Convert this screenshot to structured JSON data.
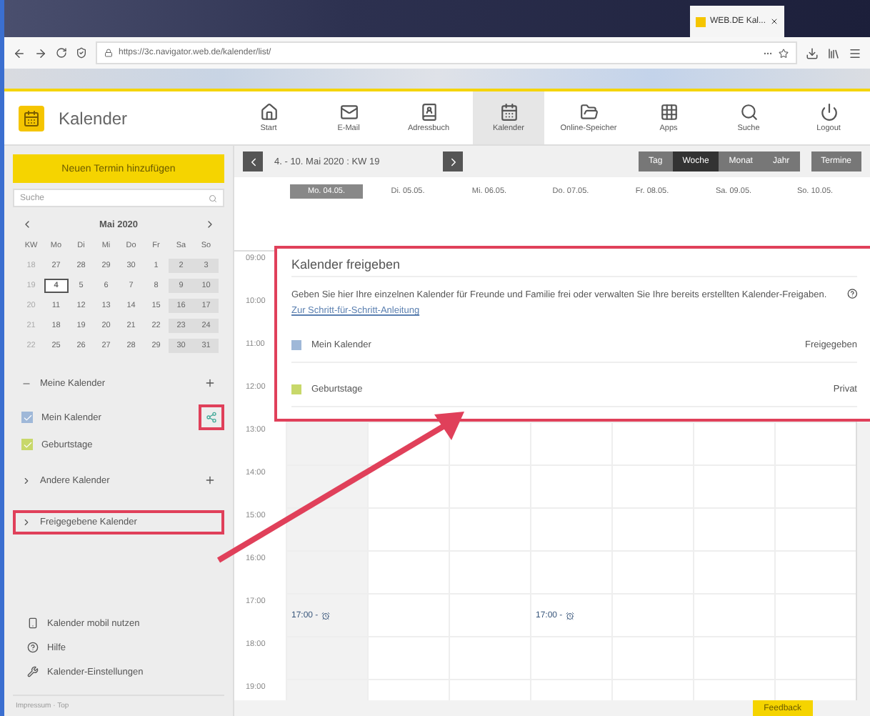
{
  "browser": {
    "tab_title": "WEB.DE Kal...",
    "url": "https://3c.navigator.web.de/kalender/list/"
  },
  "app": {
    "title": "Kalender",
    "nav": [
      {
        "label": "Start",
        "selected": false
      },
      {
        "label": "E-Mail",
        "selected": false
      },
      {
        "label": "Adressbuch",
        "selected": false
      },
      {
        "label": "Kalender",
        "selected": true
      },
      {
        "label": "Online-Speicher",
        "selected": false
      },
      {
        "label": "Apps",
        "selected": false
      },
      {
        "label": "Suche",
        "selected": false
      },
      {
        "label": "Logout",
        "selected": false
      }
    ]
  },
  "sidebar": {
    "new_button": "Neuen Termin hinzufügen",
    "search": {
      "placeholder": "Suche"
    },
    "mini_calendar": {
      "title": "Mai 2020",
      "weekdays": [
        "KW",
        "Mo",
        "Di",
        "Mi",
        "Do",
        "Fr",
        "Sa",
        "So"
      ],
      "weeks": [
        {
          "week": "18",
          "days": [
            {
              "label": "27",
              "today": false
            },
            {
              "label": "28",
              "today": false
            },
            {
              "label": "29",
              "today": false
            },
            {
              "label": "30",
              "today": false
            },
            {
              "label": "1",
              "today": false
            },
            {
              "label": "2",
              "today": false
            },
            {
              "label": "3",
              "today": false
            }
          ]
        },
        {
          "week": "19",
          "days": [
            {
              "label": "4",
              "today": true
            },
            {
              "label": "5",
              "today": false
            },
            {
              "label": "6",
              "today": false
            },
            {
              "label": "7",
              "today": false
            },
            {
              "label": "8",
              "today": false
            },
            {
              "label": "9",
              "today": false
            },
            {
              "label": "10",
              "today": false
            }
          ]
        },
        {
          "week": "20",
          "days": [
            {
              "label": "11",
              "today": false
            },
            {
              "label": "12",
              "today": false
            },
            {
              "label": "13",
              "today": false
            },
            {
              "label": "14",
              "today": false
            },
            {
              "label": "15",
              "today": false
            },
            {
              "label": "16",
              "today": false
            },
            {
              "label": "17",
              "today": false
            }
          ]
        },
        {
          "week": "21",
          "days": [
            {
              "label": "18",
              "today": false
            },
            {
              "label": "19",
              "today": false
            },
            {
              "label": "20",
              "today": false
            },
            {
              "label": "21",
              "today": false
            },
            {
              "label": "22",
              "today": false
            },
            {
              "label": "23",
              "today": false
            },
            {
              "label": "24",
              "today": false
            }
          ]
        },
        {
          "week": "22",
          "days": [
            {
              "label": "25",
              "today": false
            },
            {
              "label": "26",
              "today": false
            },
            {
              "label": "27",
              "today": false
            },
            {
              "label": "28",
              "today": false
            },
            {
              "label": "29",
              "today": false
            },
            {
              "label": "30",
              "today": false
            },
            {
              "label": "31",
              "today": false
            }
          ]
        }
      ]
    },
    "groups": [
      {
        "title": "Meine Kalender",
        "expanded": true,
        "highlighted": false,
        "items": [
          {
            "label": "Mein Kalender",
            "checked": true,
            "color": "#9fb8d8",
            "shared": true,
            "highlighted": true
          },
          {
            "label": "Geburtstage",
            "checked": true,
            "color": "#c8d86a",
            "shared": false
          }
        ]
      },
      {
        "title": "Andere Kalender",
        "expanded": false,
        "highlighted": false
      },
      {
        "title": "Freigegebene Kalender",
        "expanded": false,
        "highlighted": true
      }
    ],
    "links": [
      "Kalender mobil nutzen",
      "Hilfe",
      "Kalender-Einstellungen"
    ],
    "footer": "Impressum · Top"
  },
  "calendar": {
    "range": "4. - 10. Mai 2020 : KW 19",
    "views": [
      {
        "label": "Tag",
        "selected": false
      },
      {
        "label": "Woche",
        "selected": true
      },
      {
        "label": "Monat",
        "selected": false
      },
      {
        "label": "Jahr",
        "selected": false
      }
    ],
    "list_button": "Termine",
    "days": [
      {
        "label": "Mo. 04.05.",
        "today": true,
        "event": "17:00 -"
      },
      {
        "label": "Di. 05.05.",
        "today": false
      },
      {
        "label": "Mi. 06.05.",
        "today": false
      },
      {
        "label": "Do. 07.05.",
        "today": false,
        "event": "17:00 -"
      },
      {
        "label": "Fr. 08.05.",
        "today": false
      },
      {
        "label": "Sa. 09.05.",
        "today": false
      },
      {
        "label": "So. 10.05.",
        "today": false
      }
    ],
    "hours": [
      "09:00",
      "10:00",
      "11:00",
      "12:00",
      "13:00",
      "14:00",
      "15:00",
      "16:00",
      "17:00",
      "18:00",
      "19:00"
    ],
    "feedback": "Feedback"
  },
  "share_dialog": {
    "title": "Kalender freigeben",
    "text": "Geben Sie hier Ihre einzelnen Kalender für Freunde und Familie frei oder verwalten Sie Ihre bereits erstellten Kalender-Freigaben.",
    "link": "Zur Schritt-für-Schritt-Anleitung",
    "highlighted": true,
    "rows": [
      {
        "label": "Mein Kalender",
        "color": "#9fb8d8",
        "status": "Freigegeben"
      },
      {
        "label": "Geburtstage",
        "color": "#c8d86a",
        "status": "Privat"
      }
    ]
  }
}
